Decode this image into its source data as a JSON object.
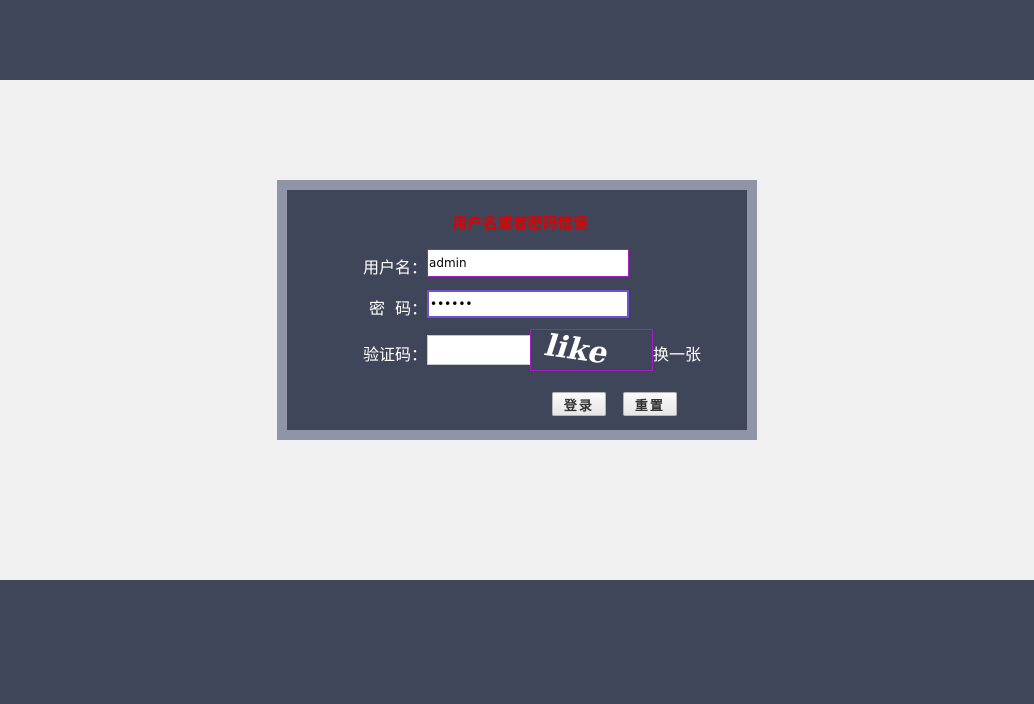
{
  "login": {
    "error_message": "用户名或者密码错误",
    "username_label": "用户名：",
    "username_value": "admin",
    "password_label": "密  码：",
    "password_value": "••••••",
    "captcha_label": "验证码：",
    "captcha_value": "",
    "captcha_text": "like",
    "refresh_label": "换一张",
    "login_button": "登录",
    "reset_button": "重置"
  },
  "colors": {
    "band": "#404659",
    "page_bg": "#f0f0f0",
    "frame": "#8f95a6",
    "error": "#e00000",
    "input_border": "#a020c0"
  }
}
